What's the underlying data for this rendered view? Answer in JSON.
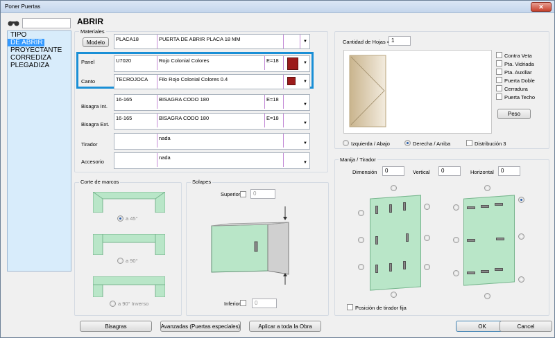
{
  "window": {
    "title": "Poner Puertas",
    "close": "✕"
  },
  "search": {
    "value": ""
  },
  "list": {
    "items": [
      "TIPO",
      "DE ABRIR",
      "PROYECTANTE",
      "CORREDIZA",
      "PLEGADIZA"
    ],
    "selected": 1
  },
  "heading": "ABRIR",
  "materiales": {
    "label": "Materiales",
    "modelo_btn": "Modelo",
    "modelo": {
      "code": "PLACA18",
      "desc": "PUERTA DE ABRIR PLACA 18 MM"
    },
    "panel": {
      "label": "Panel",
      "code": "U7020",
      "desc": "Rojo Colonial Colores",
      "thick": "E=18",
      "color": "#9c1b1b"
    },
    "canto": {
      "label": "Canto",
      "code": "TECROJOCA",
      "desc": "Filo Rojo Colonial Colores 0.4",
      "color": "#9c1b1b"
    },
    "highlight_color": "#1a8fd6",
    "bisagra_int": {
      "label": "Bisagra Int.",
      "code": "16-165",
      "desc": "BISAGRA CODO 180",
      "thick": "E=18"
    },
    "bisagra_ext": {
      "label": "Bisagra Ext.",
      "code": "16-165",
      "desc": "BISAGRA CODO 180",
      "thick": "E=18"
    },
    "tirador": {
      "label": "Tirador",
      "code": "",
      "desc": "nada"
    },
    "accesorio": {
      "label": "Accesorio",
      "code": "",
      "desc": "nada"
    }
  },
  "corte": {
    "title": "Corte de marcos",
    "options": [
      "a 45°",
      "a 90°",
      "a 90° Inverso"
    ],
    "selected": 0
  },
  "solapes": {
    "title": "Solapes",
    "superior": "Superior",
    "inferior": "Inferior",
    "superior_value": "0",
    "inferior_value": "0"
  },
  "hojas": {
    "label": "Cantidad de Hojas =",
    "value": "1",
    "checks": [
      "Contra Veta",
      "Pta. Vidriada",
      "Pta. Auxiliar",
      "Puerta Doble",
      "Cerradura",
      "Puerta Techo"
    ],
    "peso": "Peso",
    "radios": [
      "Izquierda / Abajo",
      "Derecha / Arriba"
    ],
    "radio_selected": 1,
    "distribucion": "Distribución 3"
  },
  "manija": {
    "title": "Manija / Tirador",
    "dimension_label": "Dimensión",
    "dimension": "0",
    "vertical_label": "Vertical",
    "vertical": "0",
    "horizontal_label": "Horizontal",
    "horizontal": "0",
    "posicion": "Posición de tirador fija"
  },
  "footer": {
    "bisagras": "Bisagras",
    "avanzadas": "Avanzadas (Puertas especiales)",
    "aplicar": "Aplicar a toda la Obra",
    "ok": "OK",
    "cancel": "Cancel"
  }
}
